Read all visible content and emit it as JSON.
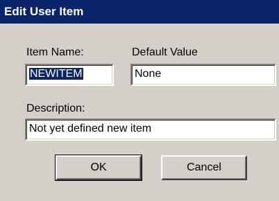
{
  "window": {
    "title": "Edit User Item"
  },
  "form": {
    "item_name_label": "Item Name:",
    "item_name_value": "NEWITEM",
    "default_value_label": "Default Value",
    "default_value_value": "None",
    "description_label": "Description:",
    "description_value": "Not yet defined new item"
  },
  "buttons": {
    "ok_label": "OK",
    "cancel_label": "Cancel"
  },
  "colors": {
    "title_bar": "#0a246a",
    "dialog_bg": "#d4d0c8",
    "selection": "#0a246a"
  }
}
